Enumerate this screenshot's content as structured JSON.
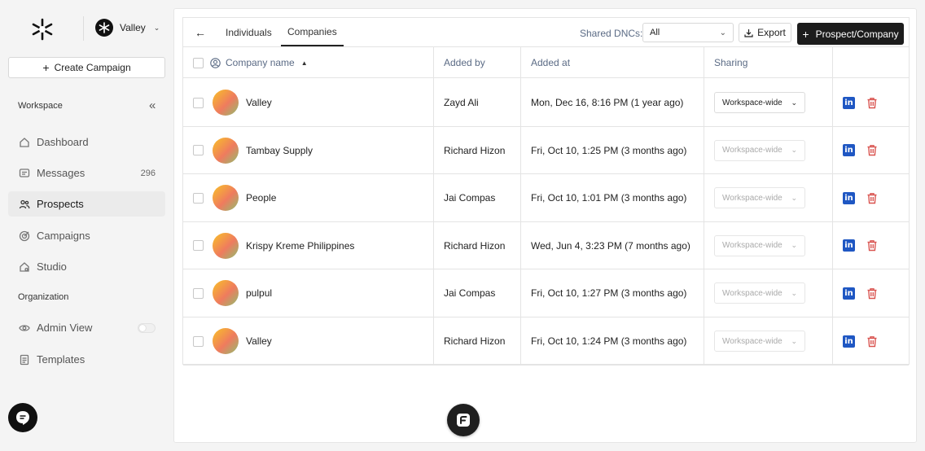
{
  "workspace": {
    "name": "Valley"
  },
  "sidebar": {
    "create_label": "Create Campaign",
    "workspace_label": "Workspace",
    "organization_label": "Organization",
    "items": [
      {
        "label": "Dashboard",
        "icon": "home-icon"
      },
      {
        "label": "Messages",
        "icon": "message-icon",
        "count": "296"
      },
      {
        "label": "Prospects",
        "icon": "users-icon",
        "active": true
      },
      {
        "label": "Campaigns",
        "icon": "target-icon"
      },
      {
        "label": "Studio",
        "icon": "studio-icon"
      }
    ],
    "org_items": [
      {
        "label": "Admin View",
        "icon": "eye-icon"
      },
      {
        "label": "Templates",
        "icon": "document-icon"
      }
    ]
  },
  "toolbar": {
    "tabs": [
      "Individuals",
      "Companies"
    ],
    "active_tab": "Companies",
    "dnc_label": "Shared DNCs:",
    "dnc_value": "All",
    "export_label": "Export",
    "prospect_label": "Prospect/Company"
  },
  "table": {
    "headers": {
      "company": "Company name",
      "added_by": "Added by",
      "added_at": "Added at",
      "sharing": "Sharing"
    },
    "rows": [
      {
        "company": "Valley",
        "added_by": "Zayd Ali",
        "added_at": "Mon, Dec 16, 8:16 PM (1 year ago)",
        "sharing": "Workspace-wide",
        "enabled": true
      },
      {
        "company": "Tambay Supply",
        "added_by": "Richard Hizon",
        "added_at": "Fri, Oct 10, 1:25 PM (3 months ago)",
        "sharing": "Workspace-wide",
        "enabled": false
      },
      {
        "company": "People",
        "added_by": "Jai Compas",
        "added_at": "Fri, Oct 10, 1:01 PM (3 months ago)",
        "sharing": "Workspace-wide",
        "enabled": false
      },
      {
        "company": "Krispy Kreme Philippines",
        "added_by": "Richard Hizon",
        "added_at": "Wed, Jun 4, 3:23 PM (7 months ago)",
        "sharing": "Workspace-wide",
        "enabled": false
      },
      {
        "company": "pulpul",
        "added_by": "Jai Compas",
        "added_at": "Fri, Oct 10, 1:27 PM (3 months ago)",
        "sharing": "Workspace-wide",
        "enabled": false
      },
      {
        "company": "Valley",
        "added_by": "Richard Hizon",
        "added_at": "Fri, Oct 10, 1:24 PM (3 months ago)",
        "sharing": "Workspace-wide",
        "enabled": false
      }
    ]
  },
  "colors": {
    "accent": "#1c1c1c",
    "linkedin": "#1f57c3",
    "delete": "#d9534f",
    "muted": "#5b6b85"
  }
}
